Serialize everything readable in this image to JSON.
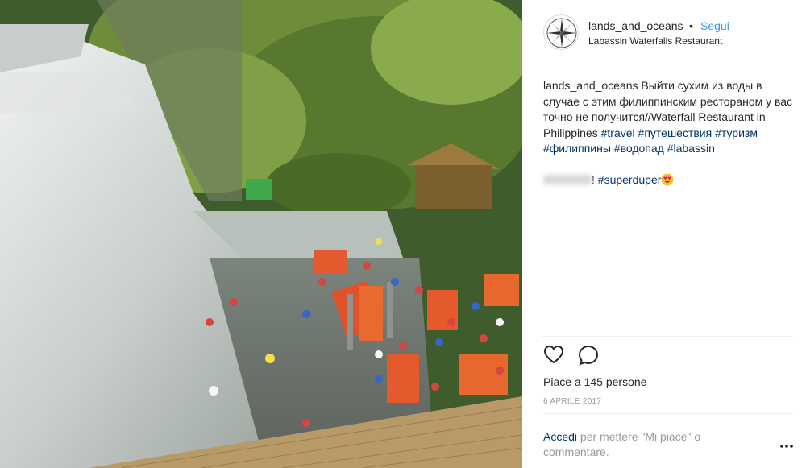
{
  "post": {
    "username": "lands_and_oceans",
    "separator": "•",
    "follow_label": "Segui",
    "location": "Labassin Waterfalls Restaurant",
    "caption": {
      "username": "lands_and_oceans",
      "text": " Выйти сухим из воды в случае с этим филиппинским рестораном у вас точно не получится//Waterfall Restaurant in Philippines ",
      "hashtags": [
        "#travel",
        "#путешествия",
        "#туризм",
        "#филиппины",
        "#водопад",
        "#labassin"
      ],
      "exclaim": "!",
      "last_hashtag": "#superduper"
    },
    "likes_text": "Piace a 145 persone",
    "date": "6 APRILE 2017",
    "login_link": "Accedi",
    "login_text": " per mettere \"Mi piace\" o commentare."
  },
  "icons": {
    "avatar": "compass-rose-icon",
    "like": "heart-icon",
    "comment": "comment-bubble-icon",
    "more": "more-options-icon",
    "emoji": "heart-eyes-emoji-icon"
  },
  "colors": {
    "follow": "#3897f0",
    "hashtag": "#003569",
    "muted": "#999999",
    "text": "#262626"
  }
}
